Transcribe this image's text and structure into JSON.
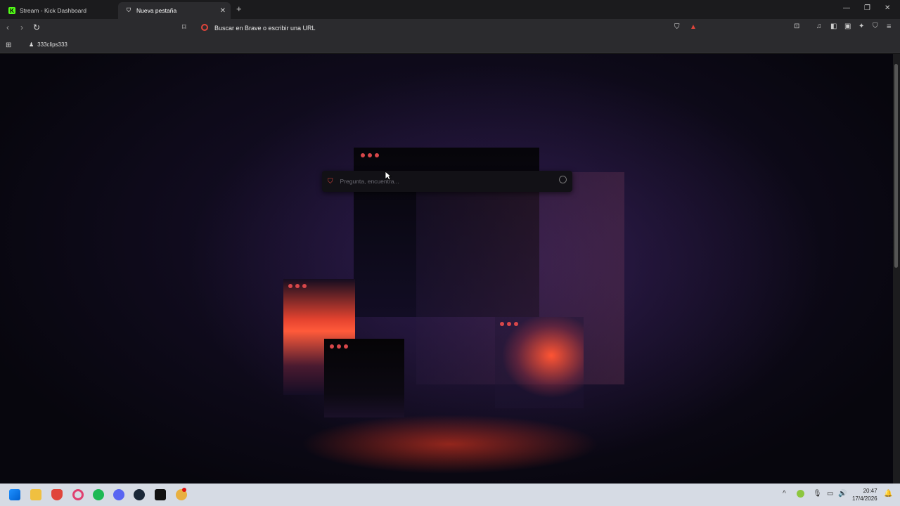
{
  "tabs": [
    {
      "title": "Stream - Kick Dashboard"
    },
    {
      "title": "Nueva pestaña"
    }
  ],
  "address_bar": {
    "placeholder": "Buscar en Brave o escribir una URL"
  },
  "bookmarks": [
    {
      "label": "333clips333"
    }
  ],
  "search_box": {
    "placeholder": "Pregunta, encuentra..."
  },
  "taskbar": {
    "time": "20:47",
    "date": "17/4/2026"
  },
  "colors": {
    "accent": "#d8474a",
    "kick_green": "#53fc18"
  }
}
